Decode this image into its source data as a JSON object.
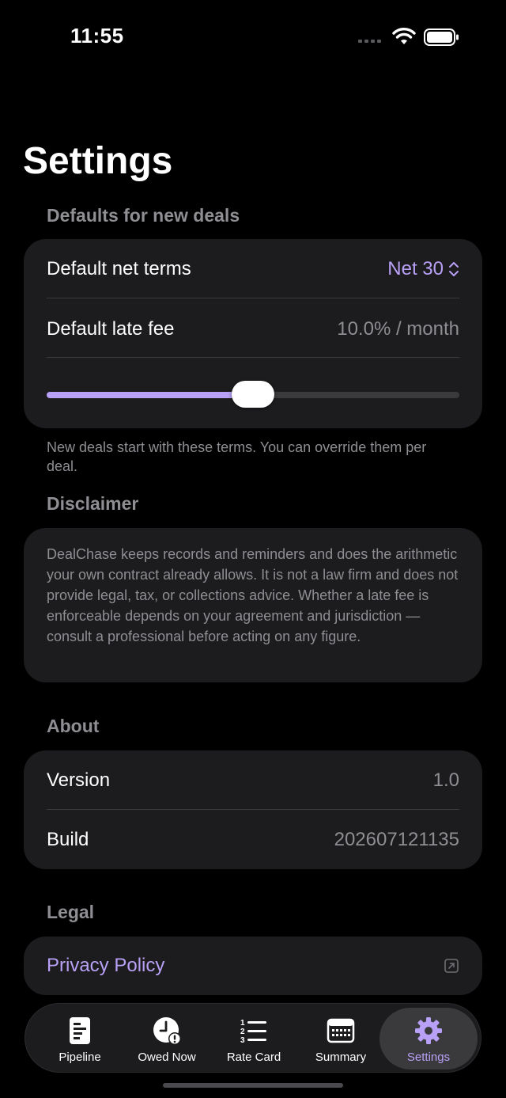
{
  "status_bar": {
    "time": "11:55"
  },
  "page": {
    "title": "Settings"
  },
  "defaults_section": {
    "header": "Defaults for new deals",
    "net_terms_label": "Default net terms",
    "net_terms_value": "Net 30",
    "late_fee_label": "Default late fee",
    "late_fee_value": "10.0% / month",
    "late_fee_slider_fraction": 0.5,
    "footnote": "New deals start with these terms. You can override them per deal."
  },
  "disclaimer_section": {
    "header": "Disclaimer",
    "text": "DealChase keeps records and reminders and does the arithmetic your own contract already allows. It is not a law firm and does not provide legal, tax, or collections advice. Whether a late fee is enforceable depends on your agreement and jurisdiction — consult a professional before acting on any figure."
  },
  "about_section": {
    "header": "About",
    "version_label": "Version",
    "version_value": "1.0",
    "build_label": "Build",
    "build_value": "202607121135"
  },
  "legal_section": {
    "header": "Legal",
    "privacy_label": "Privacy Policy"
  },
  "tab_bar": {
    "tabs": [
      {
        "label": "Pipeline",
        "icon": "document-icon"
      },
      {
        "label": "Owed Now",
        "icon": "clock-alert-icon"
      },
      {
        "label": "Rate Card",
        "icon": "numbered-list-icon"
      },
      {
        "label": "Summary",
        "icon": "calendar-icon"
      },
      {
        "label": "Settings",
        "icon": "gear-icon",
        "active": true
      }
    ]
  },
  "colors": {
    "accent": "#b7a0f5",
    "background": "#000000",
    "card": "#1c1c1e",
    "secondary_text": "#8e8e93"
  }
}
